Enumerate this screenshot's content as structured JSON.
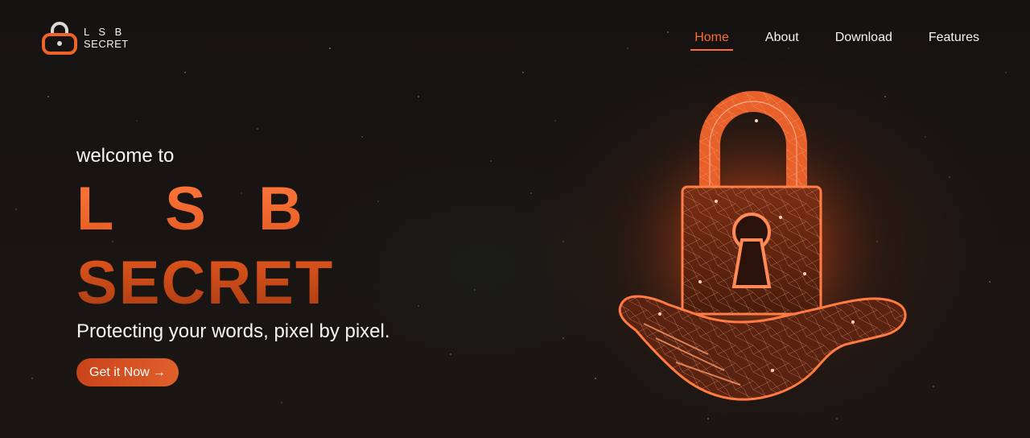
{
  "header": {
    "logo": {
      "line1": "L S B",
      "line2": "SECRET",
      "icon": "padlock-icon"
    },
    "nav": [
      {
        "label": "Home",
        "active": true
      },
      {
        "label": "About",
        "active": false
      },
      {
        "label": "Download",
        "active": false
      },
      {
        "label": "Features",
        "active": false
      }
    ]
  },
  "hero": {
    "welcome": "welcome to",
    "title_line1": "L S B",
    "title_line2": "SECRET",
    "tagline": "Protecting your words, pixel by pixel.",
    "cta_label": "Get it Now",
    "cta_arrow": "→",
    "illustration": "padlock-on-hand-icon"
  },
  "colors": {
    "accent": "#ff6a2f",
    "accent_dark": "#c9431a",
    "background": "#141211",
    "text": "#f4f4f4"
  }
}
